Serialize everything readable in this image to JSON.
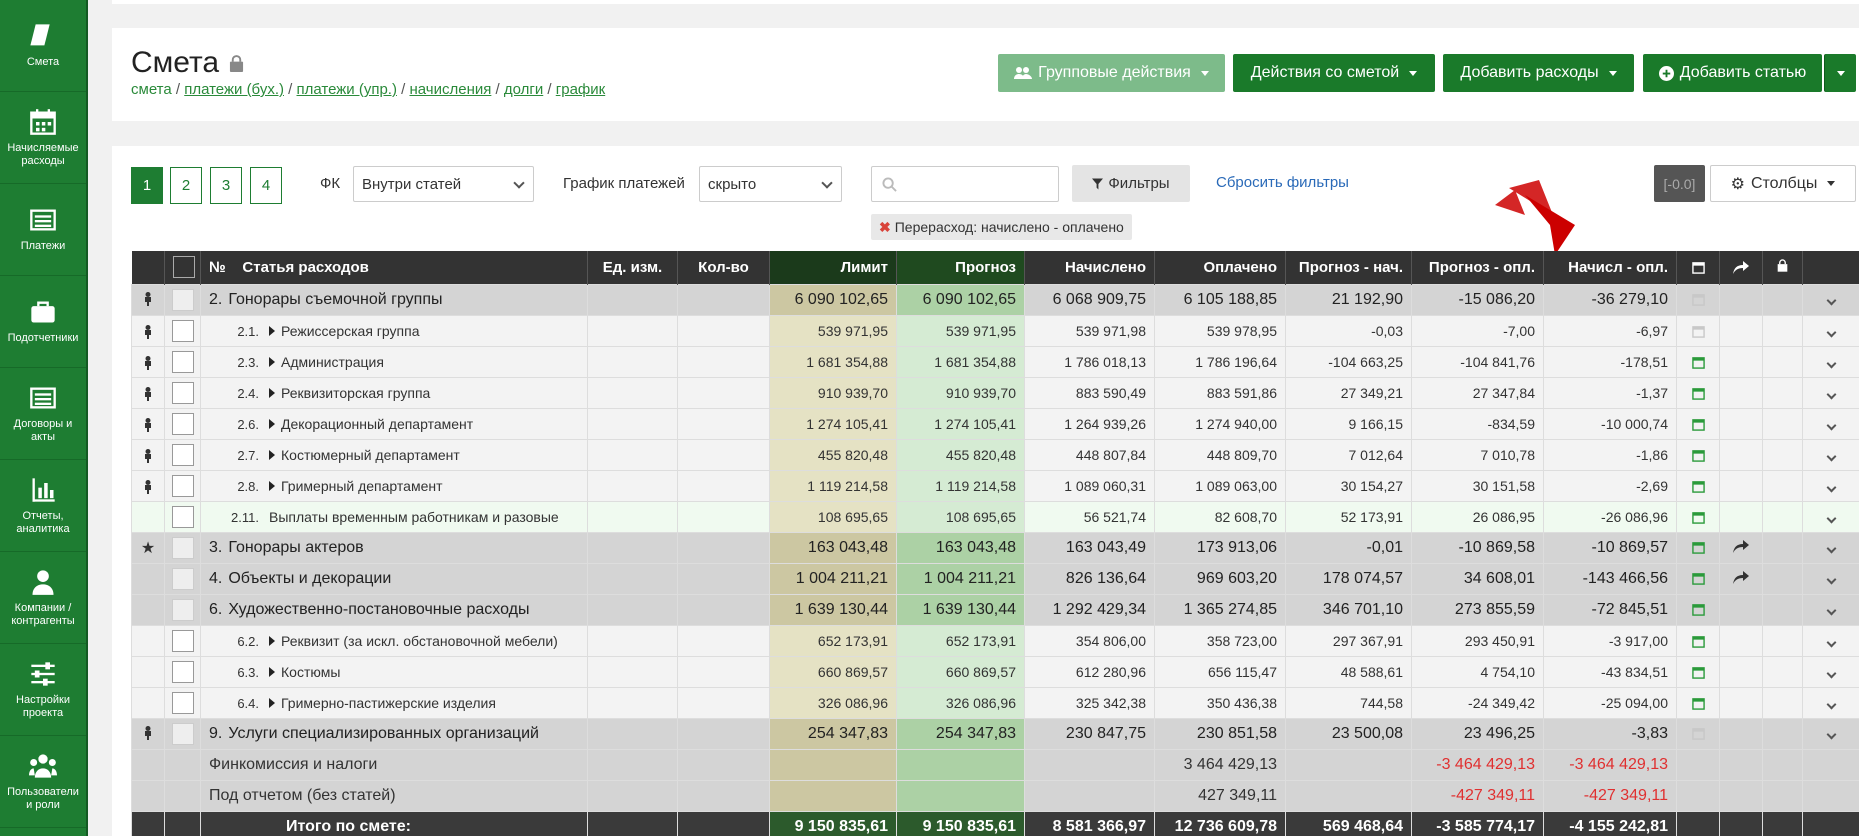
{
  "sidebar": [
    {
      "label": "Смета",
      "icon": "book-icon"
    },
    {
      "label": "Начисляемые расходы",
      "icon": "calendar-icon"
    },
    {
      "label": "Платежи",
      "icon": "list-icon"
    },
    {
      "label": "Подотчетники",
      "icon": "briefcase-icon"
    },
    {
      "label": "Договоры и акты",
      "icon": "list-icon"
    },
    {
      "label": "Отчеты, аналитика",
      "icon": "bar-chart-icon"
    },
    {
      "label": "Компании / контрагенты",
      "icon": "user-icon"
    },
    {
      "label": "Настройки проекта",
      "icon": "sliders-icon"
    },
    {
      "label": "Пользователи и роли",
      "icon": "users-icon"
    }
  ],
  "page": {
    "title": "Смета"
  },
  "breadcrumb": {
    "current": "смета",
    "links": [
      "платежи (бух.)",
      "платежи (упр.)",
      "начисления",
      "долги",
      "график"
    ],
    "separator": " / "
  },
  "header_buttons": {
    "group_actions": "Групповые действия",
    "estimate_actions": "Действия со сметой",
    "add_expenses": "Добавить расходы",
    "add_item": "Добавить статью"
  },
  "toolbar": {
    "pages": [
      "1",
      "2",
      "3",
      "4"
    ],
    "fk_label": "ФК",
    "fk_value": "Внутри статей",
    "schedule_label": "График платежей",
    "schedule_value": "скрыто",
    "filters_button": "Фильтры",
    "reset_filters": "Сбросить фильтры",
    "active_filter": "Перерасход:  начислено - оплачено",
    "version_badge": "[-0.0]",
    "columns_button": "Столбцы"
  },
  "table": {
    "headers": {
      "num": "№",
      "name": "Статья расходов",
      "unit": "Ед. изм.",
      "qty": "Кол-во",
      "limit": "Лимит",
      "forecast": "Прогноз",
      "accrued": "Начислено",
      "paid": "Оплачено",
      "f_minus_a": "Прогноз - нач.",
      "f_minus_p": "Прогноз - опл.",
      "a_minus_p": "Начисл - опл."
    },
    "rows": [
      {
        "type": "group",
        "pin": true,
        "num": "2.",
        "name": "Гонорары съемочной группы",
        "limit": "6 090 102,65",
        "forecast": "6 090 102,65",
        "accrued": "6 068 909,75",
        "paid": "6 105 188,85",
        "fa": "21 192,90",
        "fp": "-15 086,20",
        "ap": "-36 279,10",
        "cal": "dim"
      },
      {
        "type": "sub",
        "pin": true,
        "num": "2.1.",
        "name": "Режиссерская группа",
        "limit": "539 971,95",
        "forecast": "539 971,95",
        "accrued": "539 971,98",
        "paid": "539 978,95",
        "fa": "-0,03",
        "fp": "-7,00",
        "ap": "-6,97",
        "cal": "dim"
      },
      {
        "type": "sub",
        "pin": true,
        "num": "2.3.",
        "name": "Администрация",
        "limit": "1 681 354,88",
        "forecast": "1 681 354,88",
        "accrued": "1 786 018,13",
        "paid": "1 786 196,64",
        "fa": "-104 663,25",
        "fp": "-104 841,76",
        "ap": "-178,51",
        "cal": "green"
      },
      {
        "type": "sub",
        "pin": true,
        "num": "2.4.",
        "name": "Реквизиторская группа",
        "limit": "910 939,70",
        "forecast": "910 939,70",
        "accrued": "883 590,49",
        "paid": "883 591,86",
        "fa": "27 349,21",
        "fp": "27 347,84",
        "ap": "-1,37",
        "cal": "green"
      },
      {
        "type": "sub",
        "pin": true,
        "num": "2.6.",
        "name": "Декорационный департамент",
        "limit": "1 274 105,41",
        "forecast": "1 274 105,41",
        "accrued": "1 264 939,26",
        "paid": "1 274 940,00",
        "fa": "9 166,15",
        "fp": "-834,59",
        "ap": "-10 000,74",
        "cal": "green"
      },
      {
        "type": "sub",
        "pin": true,
        "num": "2.7.",
        "name": "Костюмерный департамент",
        "limit": "455 820,48",
        "forecast": "455 820,48",
        "accrued": "448 807,84",
        "paid": "448 809,70",
        "fa": "7 012,64",
        "fp": "7 010,78",
        "ap": "-1,86",
        "cal": "green"
      },
      {
        "type": "sub",
        "pin": true,
        "num": "2.8.",
        "name": "Гримерный департамент",
        "limit": "1 119 214,58",
        "forecast": "1 119 214,58",
        "accrued": "1 089 060,31",
        "paid": "1 089 063,00",
        "fa": "30 154,27",
        "fp": "30 151,58",
        "ap": "-2,69",
        "cal": "green"
      },
      {
        "type": "sub hl",
        "pin": false,
        "num": "2.11.",
        "name": "Выплаты временным работникам и разовые",
        "limit": "108 695,65",
        "forecast": "108 695,65",
        "accrued": "56 521,74",
        "paid": "82 608,70",
        "fa": "52 173,91",
        "fp": "26 086,95",
        "ap": "-26 086,96",
        "cal": "green",
        "notri": true
      },
      {
        "type": "group",
        "star": true,
        "num": "3.",
        "name": "Гонорары актеров",
        "limit": "163 043,48",
        "forecast": "163 043,48",
        "accrued": "163 043,49",
        "paid": "173 913,06",
        "fa": "-0,01",
        "fp": "-10 869,58",
        "ap": "-10 869,57",
        "cal": "green",
        "share": true
      },
      {
        "type": "group",
        "num": "4.",
        "name": "Объекты и декорации",
        "limit": "1 004 211,21",
        "forecast": "1 004 211,21",
        "accrued": "826 136,64",
        "paid": "969 603,20",
        "fa": "178 074,57",
        "fp": "34 608,01",
        "ap": "-143 466,56",
        "cal": "green",
        "share": true
      },
      {
        "type": "group",
        "num": "6.",
        "name": "Художественно-постановочные расходы",
        "limit": "1 639 130,44",
        "forecast": "1 639 130,44",
        "accrued": "1 292 429,34",
        "paid": "1 365 274,85",
        "fa": "346 701,10",
        "fp": "273 855,59",
        "ap": "-72 845,51",
        "cal": "green"
      },
      {
        "type": "sub",
        "num": "6.2.",
        "name": "Реквизит (за искл. обстановочной мебели)",
        "limit": "652 173,91",
        "forecast": "652 173,91",
        "accrued": "354 806,00",
        "paid": "358 723,00",
        "fa": "297 367,91",
        "fp": "293 450,91",
        "ap": "-3 917,00",
        "cal": "green"
      },
      {
        "type": "sub",
        "num": "6.3.",
        "name": "Костюмы",
        "limit": "660 869,57",
        "forecast": "660 869,57",
        "accrued": "612 280,96",
        "paid": "656 115,47",
        "fa": "48 588,61",
        "fp": "4 754,10",
        "ap": "-43 834,51",
        "cal": "green"
      },
      {
        "type": "sub",
        "num": "6.4.",
        "name": "Гримерно-пастижерские изделия",
        "limit": "326 086,96",
        "forecast": "326 086,96",
        "accrued": "325 342,38",
        "paid": "350 436,38",
        "fa": "744,58",
        "fp": "-24 349,42",
        "ap": "-25 094,00",
        "cal": "green"
      },
      {
        "type": "group",
        "pin": true,
        "num": "9.",
        "name": "Услуги специализированных организаций",
        "limit": "254 347,83",
        "forecast": "254 347,83",
        "accrued": "230 847,75",
        "paid": "230 851,58",
        "fa": "23 500,08",
        "fp": "23 496,25",
        "ap": "-3,83",
        "cal": "dim"
      }
    ],
    "special_rows": [
      {
        "name": "Финкомиссия и налоги",
        "paid": "3 464 429,13",
        "fp": "-3 464 429,13",
        "ap": "-3 464 429,13"
      },
      {
        "name": "Под отчетом (без статей)",
        "paid": "427 349,11",
        "fp": "-427 349,11",
        "ap": "-427 349,11"
      }
    ],
    "total": {
      "name": "Итого по смете:",
      "limit": "9 150 835,61",
      "forecast": "9 150 835,61",
      "accrued": "8 581 366,97",
      "paid": "12 736 609,78",
      "fa": "569 468,64",
      "fp": "-3 585 774,17",
      "ap": "-4 155 242,81"
    }
  },
  "colors": {
    "brand": "#1e7d32",
    "negative": "#e03030",
    "limit_bg": "#e5e2c4",
    "forecast_bg": "#d5ebd3"
  }
}
